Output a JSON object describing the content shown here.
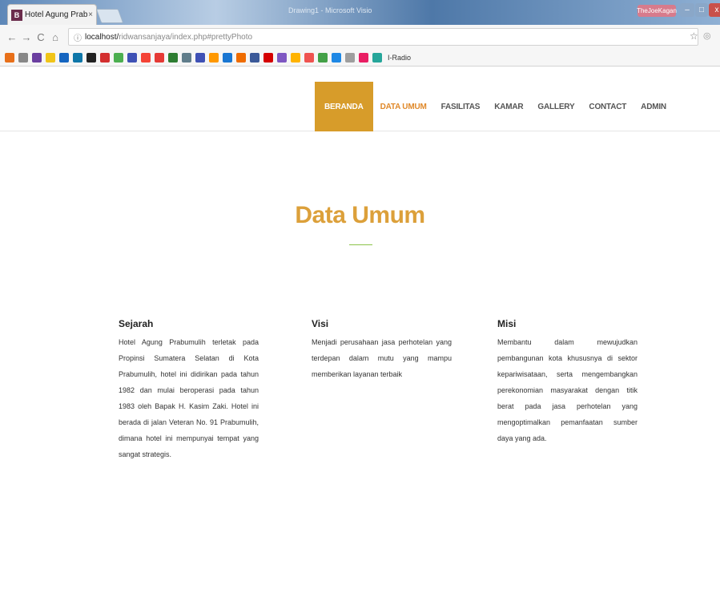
{
  "browser": {
    "tab_title": "Hotel Agung Prabumulih",
    "tab_close": "×",
    "favicon_letter": "B",
    "window_title": "Drawing1 - Microsoft Visio",
    "window_user": "TheJoeKagan",
    "url_host": "localhost/",
    "url_path": "ridwansanjaya/index.php#prettyPhoto",
    "bookmark_label": "I-Radio",
    "icons": {
      "back": "back-arrow-icon",
      "forward": "forward-arrow-icon",
      "reload": "reload-icon",
      "home": "home-icon",
      "info": "info-icon",
      "star": "star-icon"
    },
    "bookmark_colors": [
      "#e8701a",
      "#888888",
      "#6b3fa0",
      "#f0c419",
      "#1565c0",
      "#0e76a8",
      "#222222",
      "#d32f2f",
      "#4caf50",
      "#3f51b5",
      "#f44336",
      "#e53935",
      "#2e7d32",
      "#607d8b",
      "#3f51b5",
      "#ff9800",
      "#1976d2",
      "#ef6c00",
      "#3b5998",
      "#d50000",
      "#7e57c2",
      "#ffb300",
      "#ef5350",
      "#43a047",
      "#1e88e5",
      "#9e9e9e",
      "#e91e63",
      "#26a69a"
    ]
  },
  "nav": {
    "items": [
      {
        "label": "BERANDA",
        "state": "active"
      },
      {
        "label": "DATA UMUM",
        "state": "current"
      },
      {
        "label": "FASILITAS",
        "state": "normal"
      },
      {
        "label": "KAMAR",
        "state": "normal"
      },
      {
        "label": "GALLERY",
        "state": "normal"
      },
      {
        "label": "CONTACT",
        "state": "normal"
      },
      {
        "label": "ADMIN",
        "state": "normal"
      }
    ]
  },
  "main": {
    "title": "Data Umum",
    "columns": [
      {
        "heading": "Sejarah",
        "body": "Hotel Agung Prabumulih terletak pada Propinsi Sumatera Selatan di Kota Prabumulih, hotel ini didirikan pada tahun 1982 dan mulai beroperasi pada tahun 1983 oleh Bapak H. Kasim Zaki. Hotel ini berada di jalan Veteran No. 91 Prabumulih, dimana hotel ini mempunyai tempat yang sangat strategis."
      },
      {
        "heading": "Visi",
        "body": "Menjadi perusahaan jasa perhotelan yang terdepan dalam mutu yang mampu memberikan layanan terbaik"
      },
      {
        "heading": "Misi",
        "body": "Membantu dalam mewujudkan pembangunan kota khususnya di sektor kepariwisataan, serta mengembangkan perekonomian masyarakat dengan titik berat pada jasa perhotelan yang mengoptimalkan pemanfaatan sumber daya yang ada."
      }
    ]
  },
  "colors": {
    "accent": "#d79c2a",
    "title": "#dca03a",
    "current_nav": "#e0892a",
    "rule": "#8bc34a"
  }
}
